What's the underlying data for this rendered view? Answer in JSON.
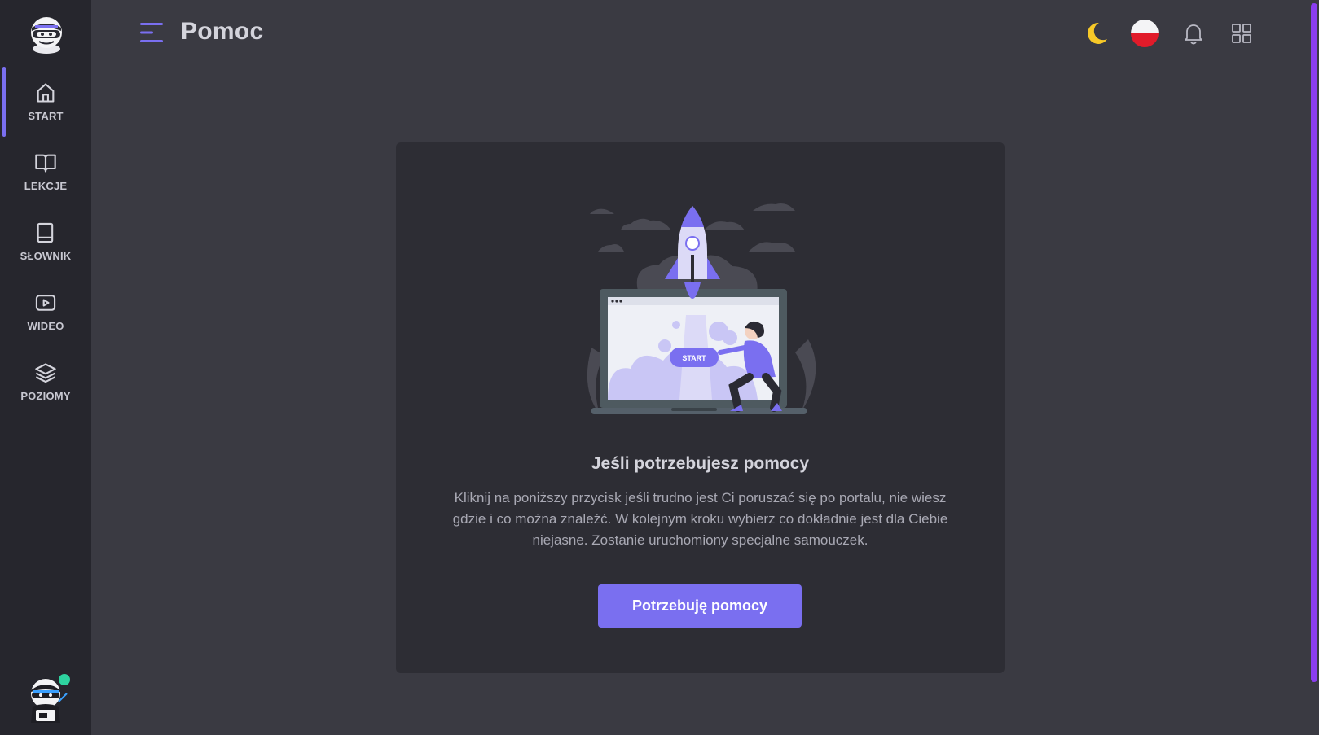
{
  "page": {
    "title": "Pomoc"
  },
  "sidebar": {
    "items": [
      {
        "label": "START",
        "icon": "home-icon",
        "active": true
      },
      {
        "label": "LEKCJE",
        "icon": "book-open-icon"
      },
      {
        "label": "SŁOWNIK",
        "icon": "book-icon"
      },
      {
        "label": "WIDEO",
        "icon": "video-icon"
      },
      {
        "label": "POZIOMY",
        "icon": "layers-icon"
      }
    ],
    "user_status": "online"
  },
  "header": {
    "icons": [
      "theme-moon-icon",
      "language-flag-pl-icon",
      "bell-icon",
      "grid-apps-icon"
    ]
  },
  "help": {
    "title": "Jeśli potrzebujesz pomocy",
    "description": "Kliknij na poniższy przycisk jeśli trudno jest Ci poruszać się po portalu, nie wiesz gdzie i co można znaleźć. W kolejnym kroku wybierz co dokładnie jest dla Ciebie niejasne. Zostanie uruchomiony specjalne samouczek.",
    "button_label": "Potrzebuję pomocy",
    "illustration_start_label": "START"
  },
  "colors": {
    "accent": "#7a6ff0",
    "sidebar_bg": "#26262d",
    "page_bg": "#3a3a42",
    "card_bg": "#2d2d34",
    "scrollbar": "#8a3df0",
    "online": "#2ed3a0"
  }
}
